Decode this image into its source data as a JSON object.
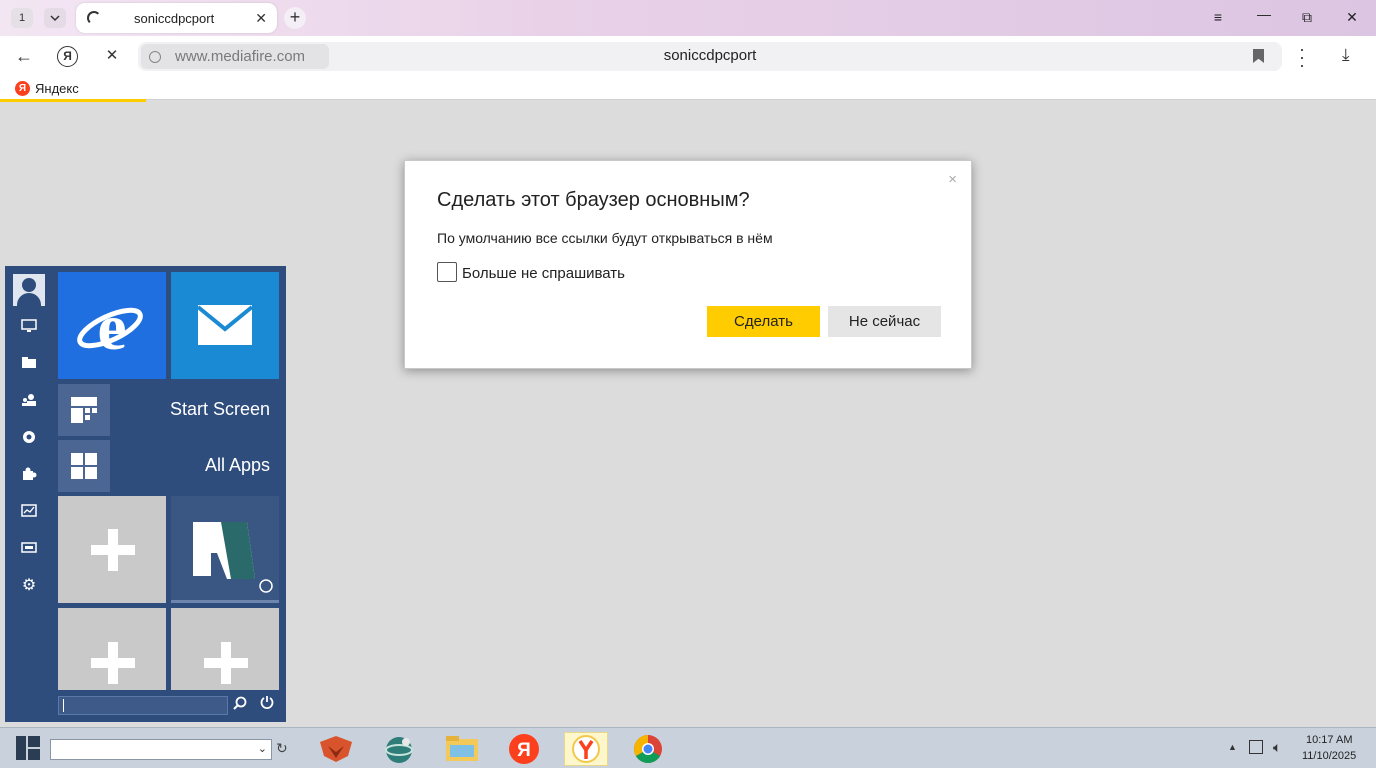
{
  "browser": {
    "tab_counter": "1",
    "tab": {
      "title": "soniccdpcport"
    },
    "new_tab_symbol": "+",
    "window_controls": {
      "menu": "≡",
      "minimize": "—",
      "restore": "⧉",
      "close": "✕"
    },
    "address": {
      "url": "www.mediafire.com",
      "page_title": "soniccdpcport"
    },
    "bookmarks": [
      {
        "icon": "yandex-logo-icon",
        "label": "Яндекс"
      }
    ],
    "accent_color": "#ffcc00"
  },
  "dialog": {
    "title": "Сделать этот браузер основным?",
    "text": "По умолчанию все ссылки будут открываться в нём",
    "checkbox_label": "Больше не спрашивать",
    "checkbox_checked": false,
    "primary_button": "Сделать",
    "secondary_button": "Не сейчас",
    "close_symbol": "×"
  },
  "start_menu": {
    "tiles": [
      {
        "icon": "internet-explorer-icon"
      },
      {
        "icon": "mail-icon"
      }
    ],
    "start_screen_label": "Start Screen",
    "all_apps_label": "All Apps",
    "sidebar_icons": [
      "user-avatar-icon",
      "computer-icon",
      "folder-icon",
      "users-icon",
      "network-icon",
      "puzzle-icon",
      "chart-icon",
      "display-icon",
      "gear-icon"
    ],
    "background_color": "#2e4c7c"
  },
  "taskbar": {
    "apps": [
      "fox-app-icon",
      "globe-app-icon",
      "file-explorer-icon",
      "yandex-red-icon",
      "yandex-browser-icon",
      "chrome-icon"
    ],
    "active_app": "yandex-browser-icon",
    "clock": {
      "time": "10:17 AM",
      "date": "11/10/2025"
    }
  }
}
